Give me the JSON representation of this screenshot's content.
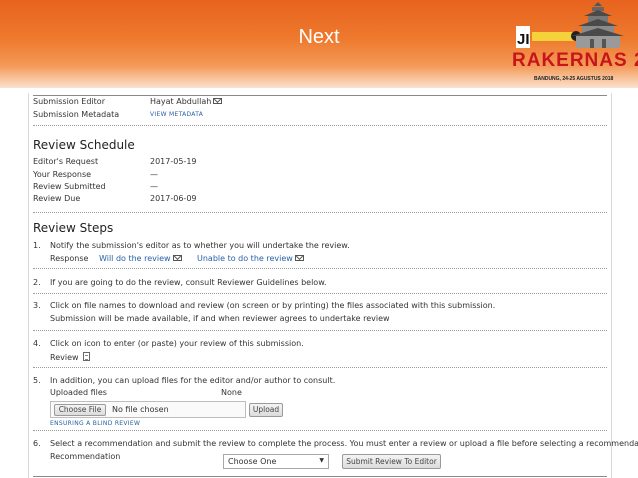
{
  "banner": {
    "title": "Next",
    "logo_small": "JI",
    "logo_word": "RAKERNAS 2",
    "logo_date": "BANDUNG, 24-25 AGUSTUS 2018"
  },
  "submission": {
    "editor_label": "Submission Editor",
    "editor_value": "Hayat Abdullah",
    "metadata_label": "Submission Metadata",
    "metadata_link": "VIEW METADATA"
  },
  "schedule": {
    "heading": "Review Schedule",
    "rows": [
      {
        "label": "Editor's Request",
        "value": "2017-05-19"
      },
      {
        "label": "Your Response",
        "value": "—"
      },
      {
        "label": "Review Submitted",
        "value": "—"
      },
      {
        "label": "Review Due",
        "value": "2017-06-09"
      }
    ]
  },
  "steps": {
    "heading": "Review Steps",
    "s1": {
      "num": "1.",
      "text": "Notify the submission's editor as to whether you will undertake the review.",
      "response_label": "Response",
      "will_do": "Will do the review",
      "unable": "Unable to do the review"
    },
    "s2": {
      "num": "2.",
      "text": "If you are going to do the review, consult Reviewer Guidelines below."
    },
    "s3": {
      "num": "3.",
      "text": "Click on file names to download and review (on screen or by printing) the files associated with this submission.",
      "note": "Submission will be made available, if and when reviewer agrees to undertake review"
    },
    "s4": {
      "num": "4.",
      "text": "Click on icon to enter (or paste) your review of this submission.",
      "review_label": "Review"
    },
    "s5": {
      "num": "5.",
      "text": "In addition, you can upload files for the editor and/or author to consult.",
      "uploaded_label": "Uploaded files",
      "uploaded_value": "None",
      "choose_file": "Choose File",
      "no_file": "No file chosen",
      "upload": "Upload",
      "blind_link": "ENSURING A BLIND REVIEW"
    },
    "s6": {
      "num": "6.",
      "text": "Select a recommendation and submit the review to complete the process. You must enter a review or upload a file before selecting a recommendation.",
      "recommendation_label": "Recommendation",
      "select_value": "Choose One",
      "submit": "Submit Review To Editor"
    }
  }
}
